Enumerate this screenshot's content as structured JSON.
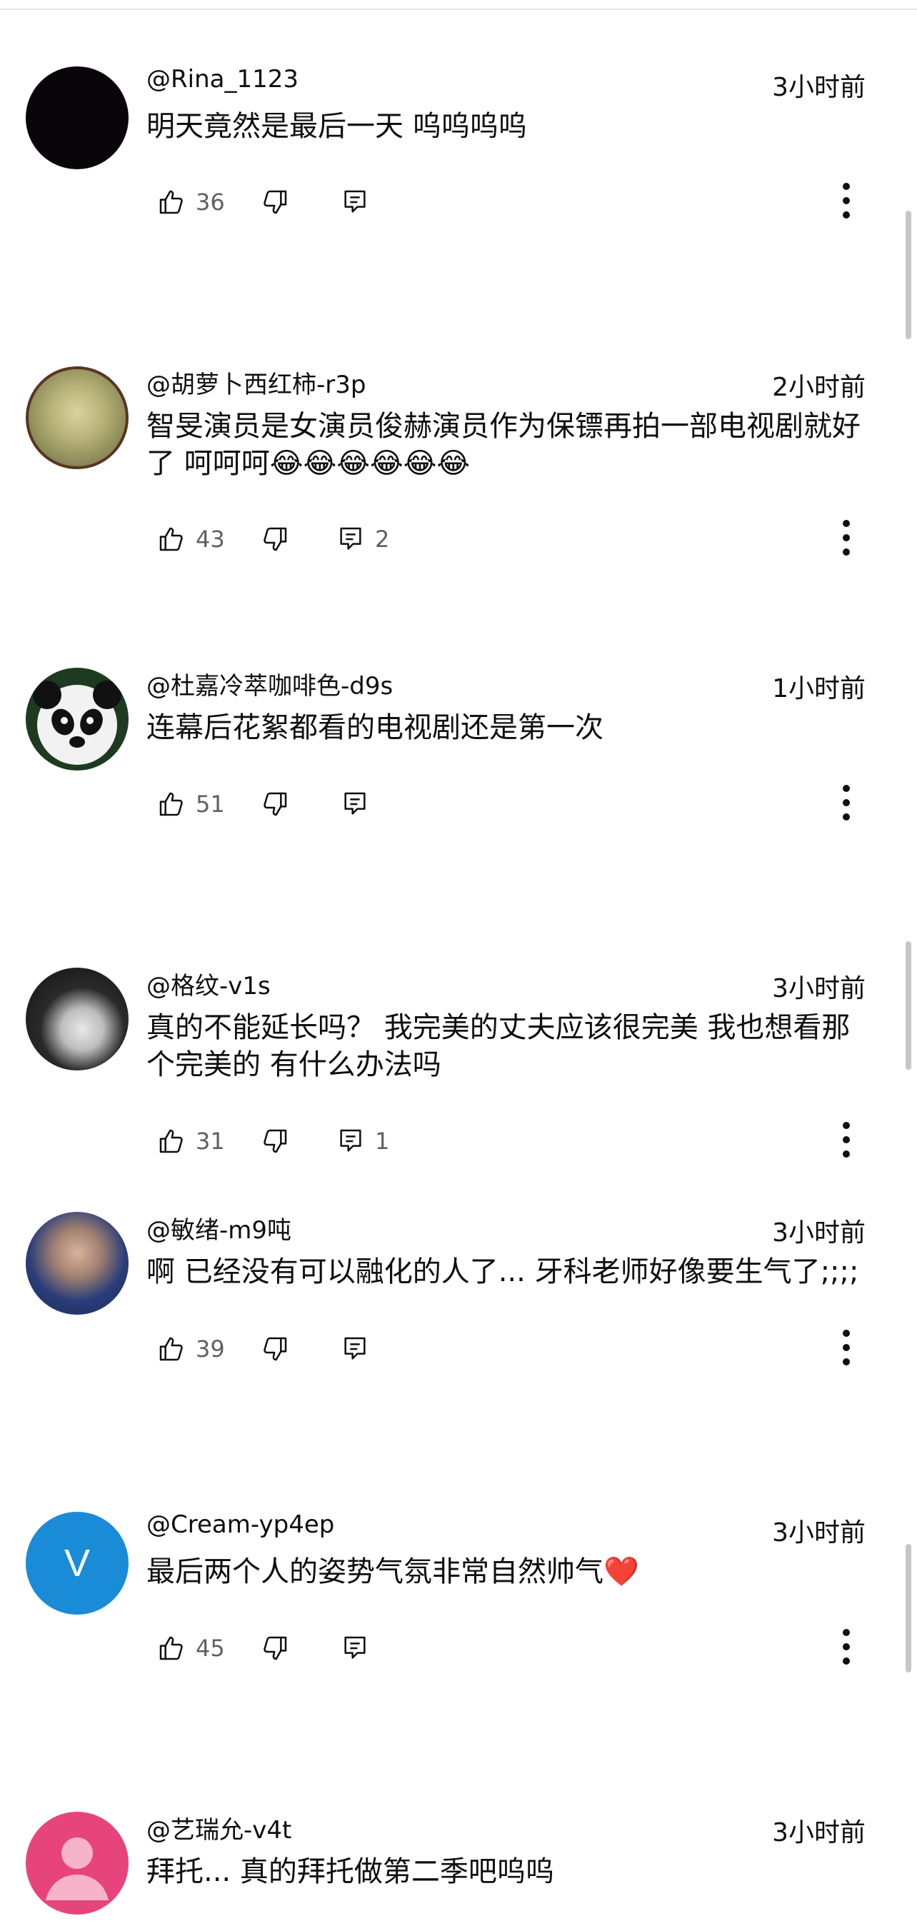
{
  "comments": [
    {
      "author": "@Rina_1123",
      "time": "3小时前",
      "text": "明天竟然是最后一天 呜呜呜呜",
      "likes": "36",
      "replies": ""
    },
    {
      "author": "@胡萝卜西红柿-r3p",
      "time": "2小时前",
      "text": "智旻演员是女演员俊赫演员作为保镖再拍一部电视剧就好了 呵呵呵😂😂😂😂😂😂",
      "likes": "43",
      "replies": "2"
    },
    {
      "author": "@杜嘉冷萃咖啡色-d9s",
      "time": "1小时前",
      "text": "连幕后花絮都看的电视剧还是第一次",
      "likes": "51",
      "replies": ""
    },
    {
      "author": "@格纹-v1s",
      "time": "3小时前",
      "text": "真的不能延长吗？ 我完美的丈夫应该很完美 我也想看那个完美的 有什么办法吗",
      "likes": "31",
      "replies": "1"
    },
    {
      "author": "@敏绪-m9吨",
      "time": "3小时前",
      "text": "啊 已经没有可以融化的人了... 牙科老师好像要生气了;;;;",
      "likes": "39",
      "replies": ""
    },
    {
      "author": "@Cream-yp4ep",
      "time": "3小时前",
      "text": "最后两个人的姿势气氛非常自然帅气❤️",
      "likes": "45",
      "replies": "",
      "avatar_letter": "V"
    },
    {
      "author": "@艺瑞允-v4t",
      "time": "3小时前",
      "text": "拜托... 真的拜托做第二季吧呜呜",
      "likes": "",
      "replies": ""
    }
  ],
  "icons": {
    "like": "thumbs-up-icon",
    "dislike": "thumbs-down-icon",
    "reply": "reply-comment-icon",
    "more": "more-vert-icon"
  },
  "colors": {
    "text": "#0f0f0f",
    "meta": "#606060",
    "avatar_v": "#1a8bd6",
    "avatar_pink": "#e8447c"
  }
}
